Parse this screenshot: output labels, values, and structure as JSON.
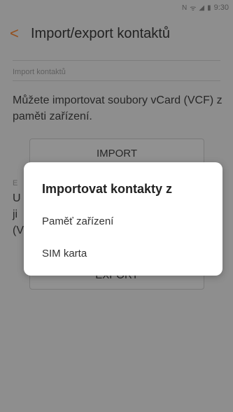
{
  "status_bar": {
    "time": "9:30"
  },
  "header": {
    "title": "Import/export kontaktů"
  },
  "import_section": {
    "header": "Import kontaktů",
    "description": "Můžete importovat soubory vCard (VCF) z paměti zařízení.",
    "button_label": "IMPORT"
  },
  "export_section": {
    "header_visible": "E",
    "description_lines_visible": [
      "U",
      "ji",
      "(V"
    ],
    "button_label": "EXPORT"
  },
  "dialog": {
    "title": "Importovat kontakty z",
    "options": [
      "Paměť zařízení",
      "SIM karta"
    ]
  }
}
